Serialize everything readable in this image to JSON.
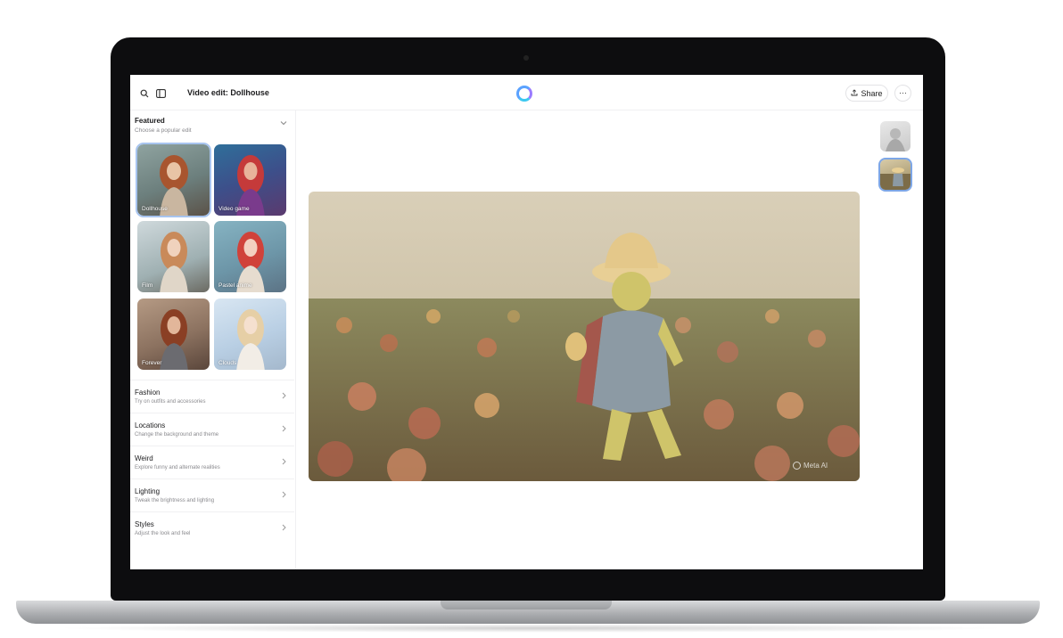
{
  "header": {
    "title": "Video edit: Dollhouse",
    "share_label": "Share",
    "more_label": "···",
    "share_icon": "upload-icon",
    "search_icon": "search-icon",
    "sidebar_toggle_icon": "sidebar-toggle-icon"
  },
  "featured": {
    "title": "Featured",
    "subtitle": "Choose a popular edit",
    "items": [
      {
        "label": "Dollhouse",
        "selected": true
      },
      {
        "label": "Video game",
        "selected": false
      },
      {
        "label": "Film",
        "selected": false
      },
      {
        "label": "Pastel anime",
        "selected": false
      },
      {
        "label": "Forever",
        "selected": false
      },
      {
        "label": "Clouds",
        "selected": false
      }
    ]
  },
  "categories": [
    {
      "title": "Fashion",
      "subtitle": "Try on outfits and accessories"
    },
    {
      "title": "Locations",
      "subtitle": "Change the background and theme"
    },
    {
      "title": "Weird",
      "subtitle": "Explore funny and alternate realities"
    },
    {
      "title": "Lighting",
      "subtitle": "Tweak the brightness and lighting"
    },
    {
      "title": "Styles",
      "subtitle": "Adjust the look and feel"
    }
  ],
  "preview": {
    "watermark": "Meta AI"
  },
  "colors": {
    "accent": "#5aa2ff",
    "selected_outline": "#a7c4ef"
  }
}
